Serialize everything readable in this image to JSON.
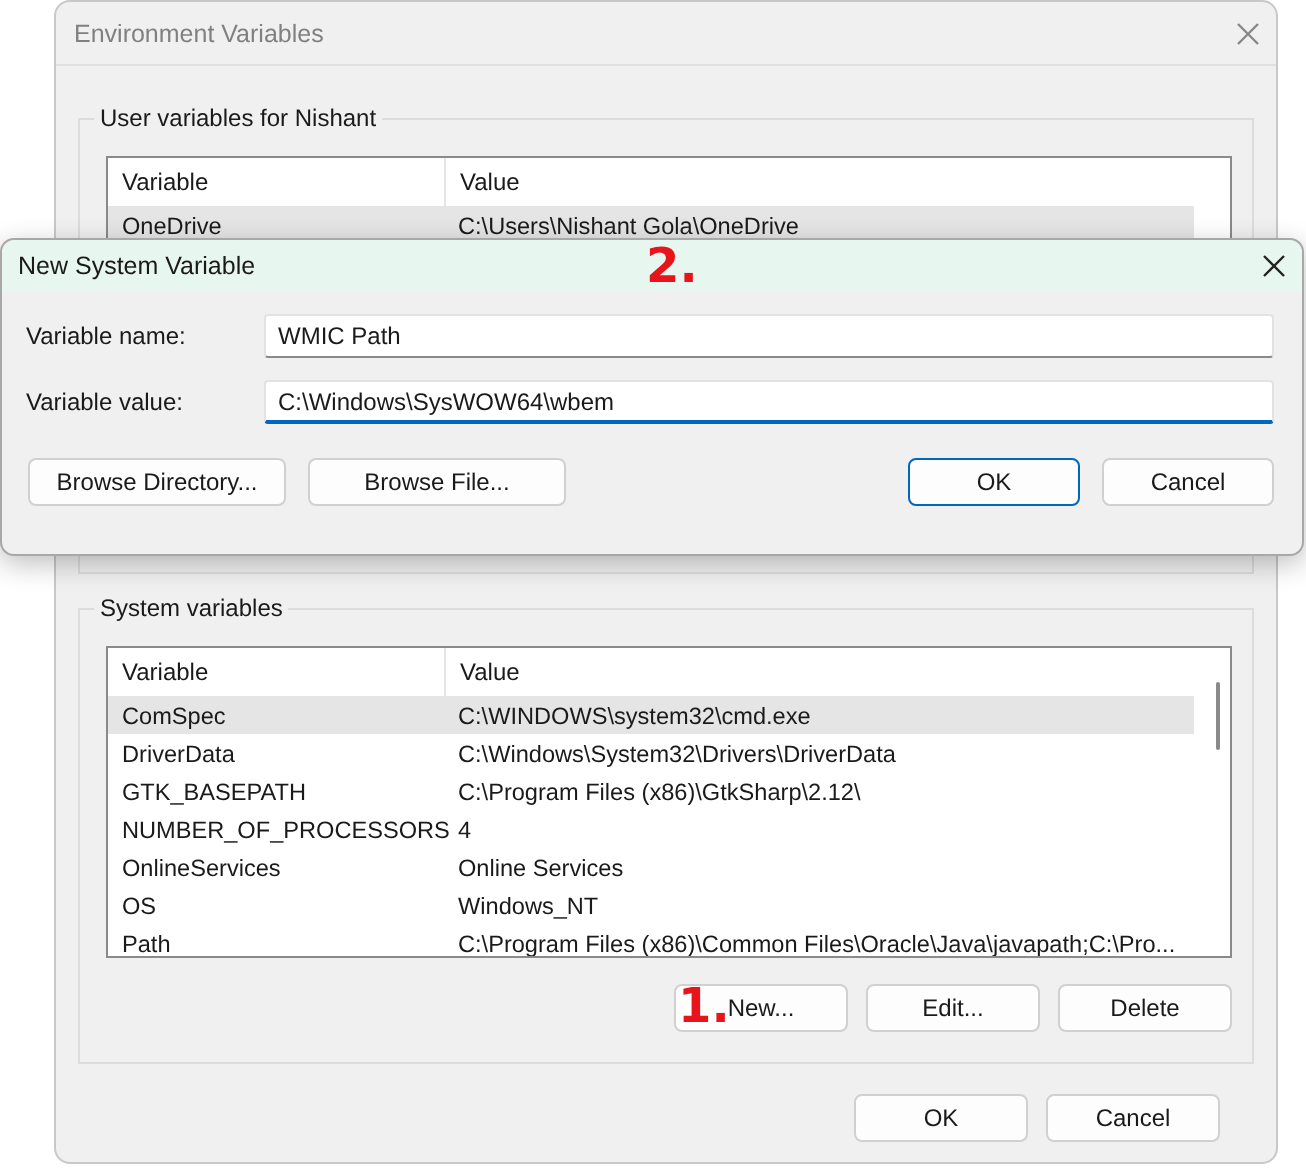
{
  "main_window": {
    "title": "Environment Variables",
    "active": false
  },
  "user_variables": {
    "title": "User variables for Nishant",
    "columns": [
      "Variable",
      "Value"
    ],
    "rows": [
      {
        "variable": "OneDrive",
        "value": "C:\\Users\\Nishant Gola\\OneDrive",
        "selected": true
      }
    ]
  },
  "dialog": {
    "title": "New System Variable",
    "active": true,
    "fields": [
      {
        "label": "Variable name:",
        "value": "WMIC Path",
        "focused": false
      },
      {
        "label": "Variable value:",
        "value": "C:\\Windows\\SysWOW64\\wbem",
        "focused": true
      }
    ],
    "left_buttons": [
      {
        "label": "Browse Directory...",
        "default": false
      },
      {
        "label": "Browse File...",
        "default": false
      }
    ],
    "right_buttons": [
      {
        "label": "OK",
        "default": true
      },
      {
        "label": "Cancel",
        "default": false
      }
    ]
  },
  "system_variables": {
    "title": "System variables",
    "columns": [
      "Variable",
      "Value"
    ],
    "rows": [
      {
        "variable": "ComSpec",
        "value": "C:\\WINDOWS\\system32\\cmd.exe",
        "selected": true
      },
      {
        "variable": "DriverData",
        "value": "C:\\Windows\\System32\\Drivers\\DriverData",
        "selected": false
      },
      {
        "variable": "GTK_BASEPATH",
        "value": "C:\\Program Files (x86)\\GtkSharp\\2.12\\",
        "selected": false
      },
      {
        "variable": "NUMBER_OF_PROCESSORS",
        "value": "4",
        "selected": false
      },
      {
        "variable": "OnlineServices",
        "value": "Online Services",
        "selected": false
      },
      {
        "variable": "OS",
        "value": "Windows_NT",
        "selected": false
      },
      {
        "variable": "Path",
        "value": "C:\\Program Files (x86)\\Common Files\\Oracle\\Java\\javapath;C:\\Pro...",
        "selected": false
      }
    ],
    "buttons": [
      {
        "label": "New...",
        "default": false
      },
      {
        "label": "Edit...",
        "default": false
      },
      {
        "label": "Delete",
        "default": false
      }
    ]
  },
  "footer_buttons": [
    {
      "label": "OK",
      "default": false
    },
    {
      "label": "Cancel",
      "default": false
    }
  ],
  "annotations": [
    {
      "text": "2."
    },
    {
      "text": "1."
    }
  ]
}
